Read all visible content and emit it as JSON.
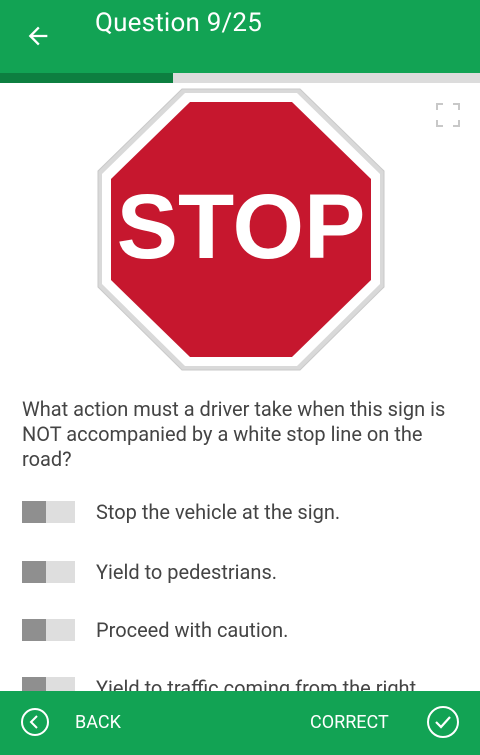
{
  "header": {
    "title": "Question 9/25",
    "back_icon": "arrow-left-icon"
  },
  "progress": {
    "current": 9,
    "total": 25,
    "fraction": 0.36
  },
  "sign": {
    "text": "STOP",
    "color": "#c6172e"
  },
  "colors": {
    "primary": "#12a354",
    "progress_fill": "#0d7f40"
  },
  "question": {
    "text": "What action must a driver take when this sign is NOT accompanied by a white stop line on the road?"
  },
  "options": [
    {
      "label": "Stop the vehicle at the sign."
    },
    {
      "label": "Yield to pedestrians."
    },
    {
      "label": "Proceed with caution."
    },
    {
      "label": "Yield to traffic coming from the right"
    }
  ],
  "footer": {
    "back_label": "BACK",
    "correct_label": "CORRECT"
  }
}
